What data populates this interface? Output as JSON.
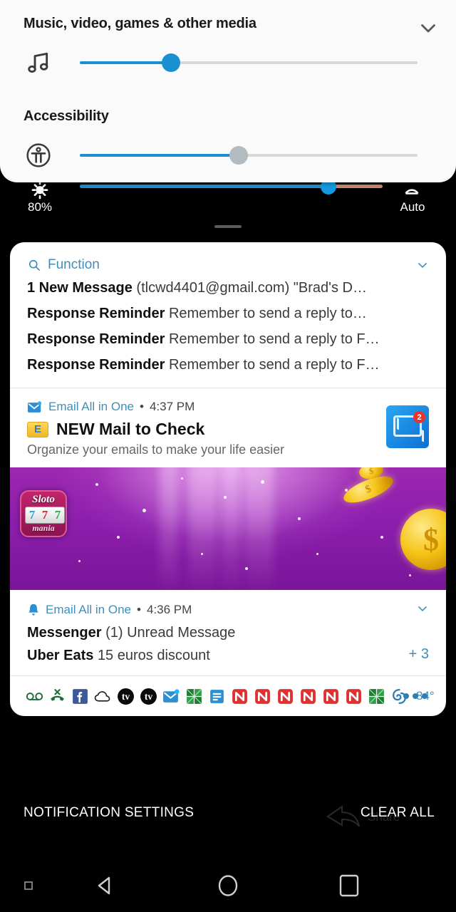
{
  "volume_panel": {
    "media": {
      "title": "Music, video, games & other media",
      "collapse_icon": "chevron-down-icon",
      "slider_icon": "music-note-icon",
      "slider_percent": 27
    },
    "accessibility": {
      "title": "Accessibility",
      "slider_icon": "accessibility-icon",
      "slider_percent": 47
    }
  },
  "brightness": {
    "icon": "brightness-sun-icon",
    "percent_label": "80%",
    "slider_percent": 82,
    "auto_label": "Auto",
    "auto_icon": "auto-brightness-icon"
  },
  "notifications": {
    "function_group": {
      "search_icon": "search-icon",
      "label": "Function",
      "collapse_icon": "chevron-down-icon",
      "messages": [
        {
          "title": "1 New Message",
          "body": "(tlcwd4401@gmail.com) \"Brad's D…"
        },
        {
          "title": "Response Reminder",
          "body": "Remember to send a reply to…"
        },
        {
          "title": "Response Reminder",
          "body": "Remember to send a reply to F…"
        },
        {
          "title": "Response Reminder",
          "body": "Remember to send a reply to F…"
        }
      ]
    },
    "email_notification": {
      "app_icon": "mail-app-icon",
      "app_name": "Email All in One",
      "separator": "•",
      "time": "4:37 PM",
      "badge_letter": "E",
      "title": "NEW Mail to Check",
      "subtitle": "Organize your emails to make your life easier",
      "big_icon": "envelope-icon",
      "big_icon_count": "2"
    },
    "ad_banner": {
      "app_icon_name": "sloto-mania-icon",
      "logo_top": "Sloto",
      "logo_reels": [
        "7",
        "7",
        "7"
      ],
      "logo_bottom": "mania",
      "background_color": "#9c27b0"
    },
    "message_group": {
      "bell_icon": "bell-icon",
      "app_name": "Email All in One",
      "separator": "•",
      "time": "4:36 PM",
      "collapse_icon": "chevron-down-icon",
      "rows": [
        {
          "title": "Messenger",
          "body": "(1) Unread Message"
        },
        {
          "title": "Uber Eats",
          "body": "15 euros discount"
        }
      ],
      "more_count": "+ 3"
    },
    "status_tray": {
      "icons": [
        "voicemail-icon",
        "missed-call-icon",
        "facebook-icon",
        "cloud-icon",
        "tv-icon",
        "tv-icon",
        "mail-icon",
        "green-grid-icon",
        "blue-document-icon",
        "news-n-icon",
        "news-n-icon",
        "news-n-icon",
        "news-n-icon",
        "news-n-icon",
        "news-n-icon",
        "green-grid-icon",
        "spiral-icon"
      ],
      "temperature": "84°",
      "overflow_icon": "more-dots-icon"
    }
  },
  "actions": {
    "notification_settings": "NOTIFICATION SETTINGS",
    "clear_all": "CLEAR ALL",
    "watermark_icon": "share-watermark-icon"
  },
  "navbar": {
    "items": [
      "dot-indicator-icon",
      "back-icon",
      "home-icon",
      "recents-icon"
    ]
  },
  "colors": {
    "accent_blue": "#1a8fd1",
    "link_blue": "#3d8fb9",
    "ad_purple": "#9c27b0",
    "badge_red": "#e8342a"
  }
}
